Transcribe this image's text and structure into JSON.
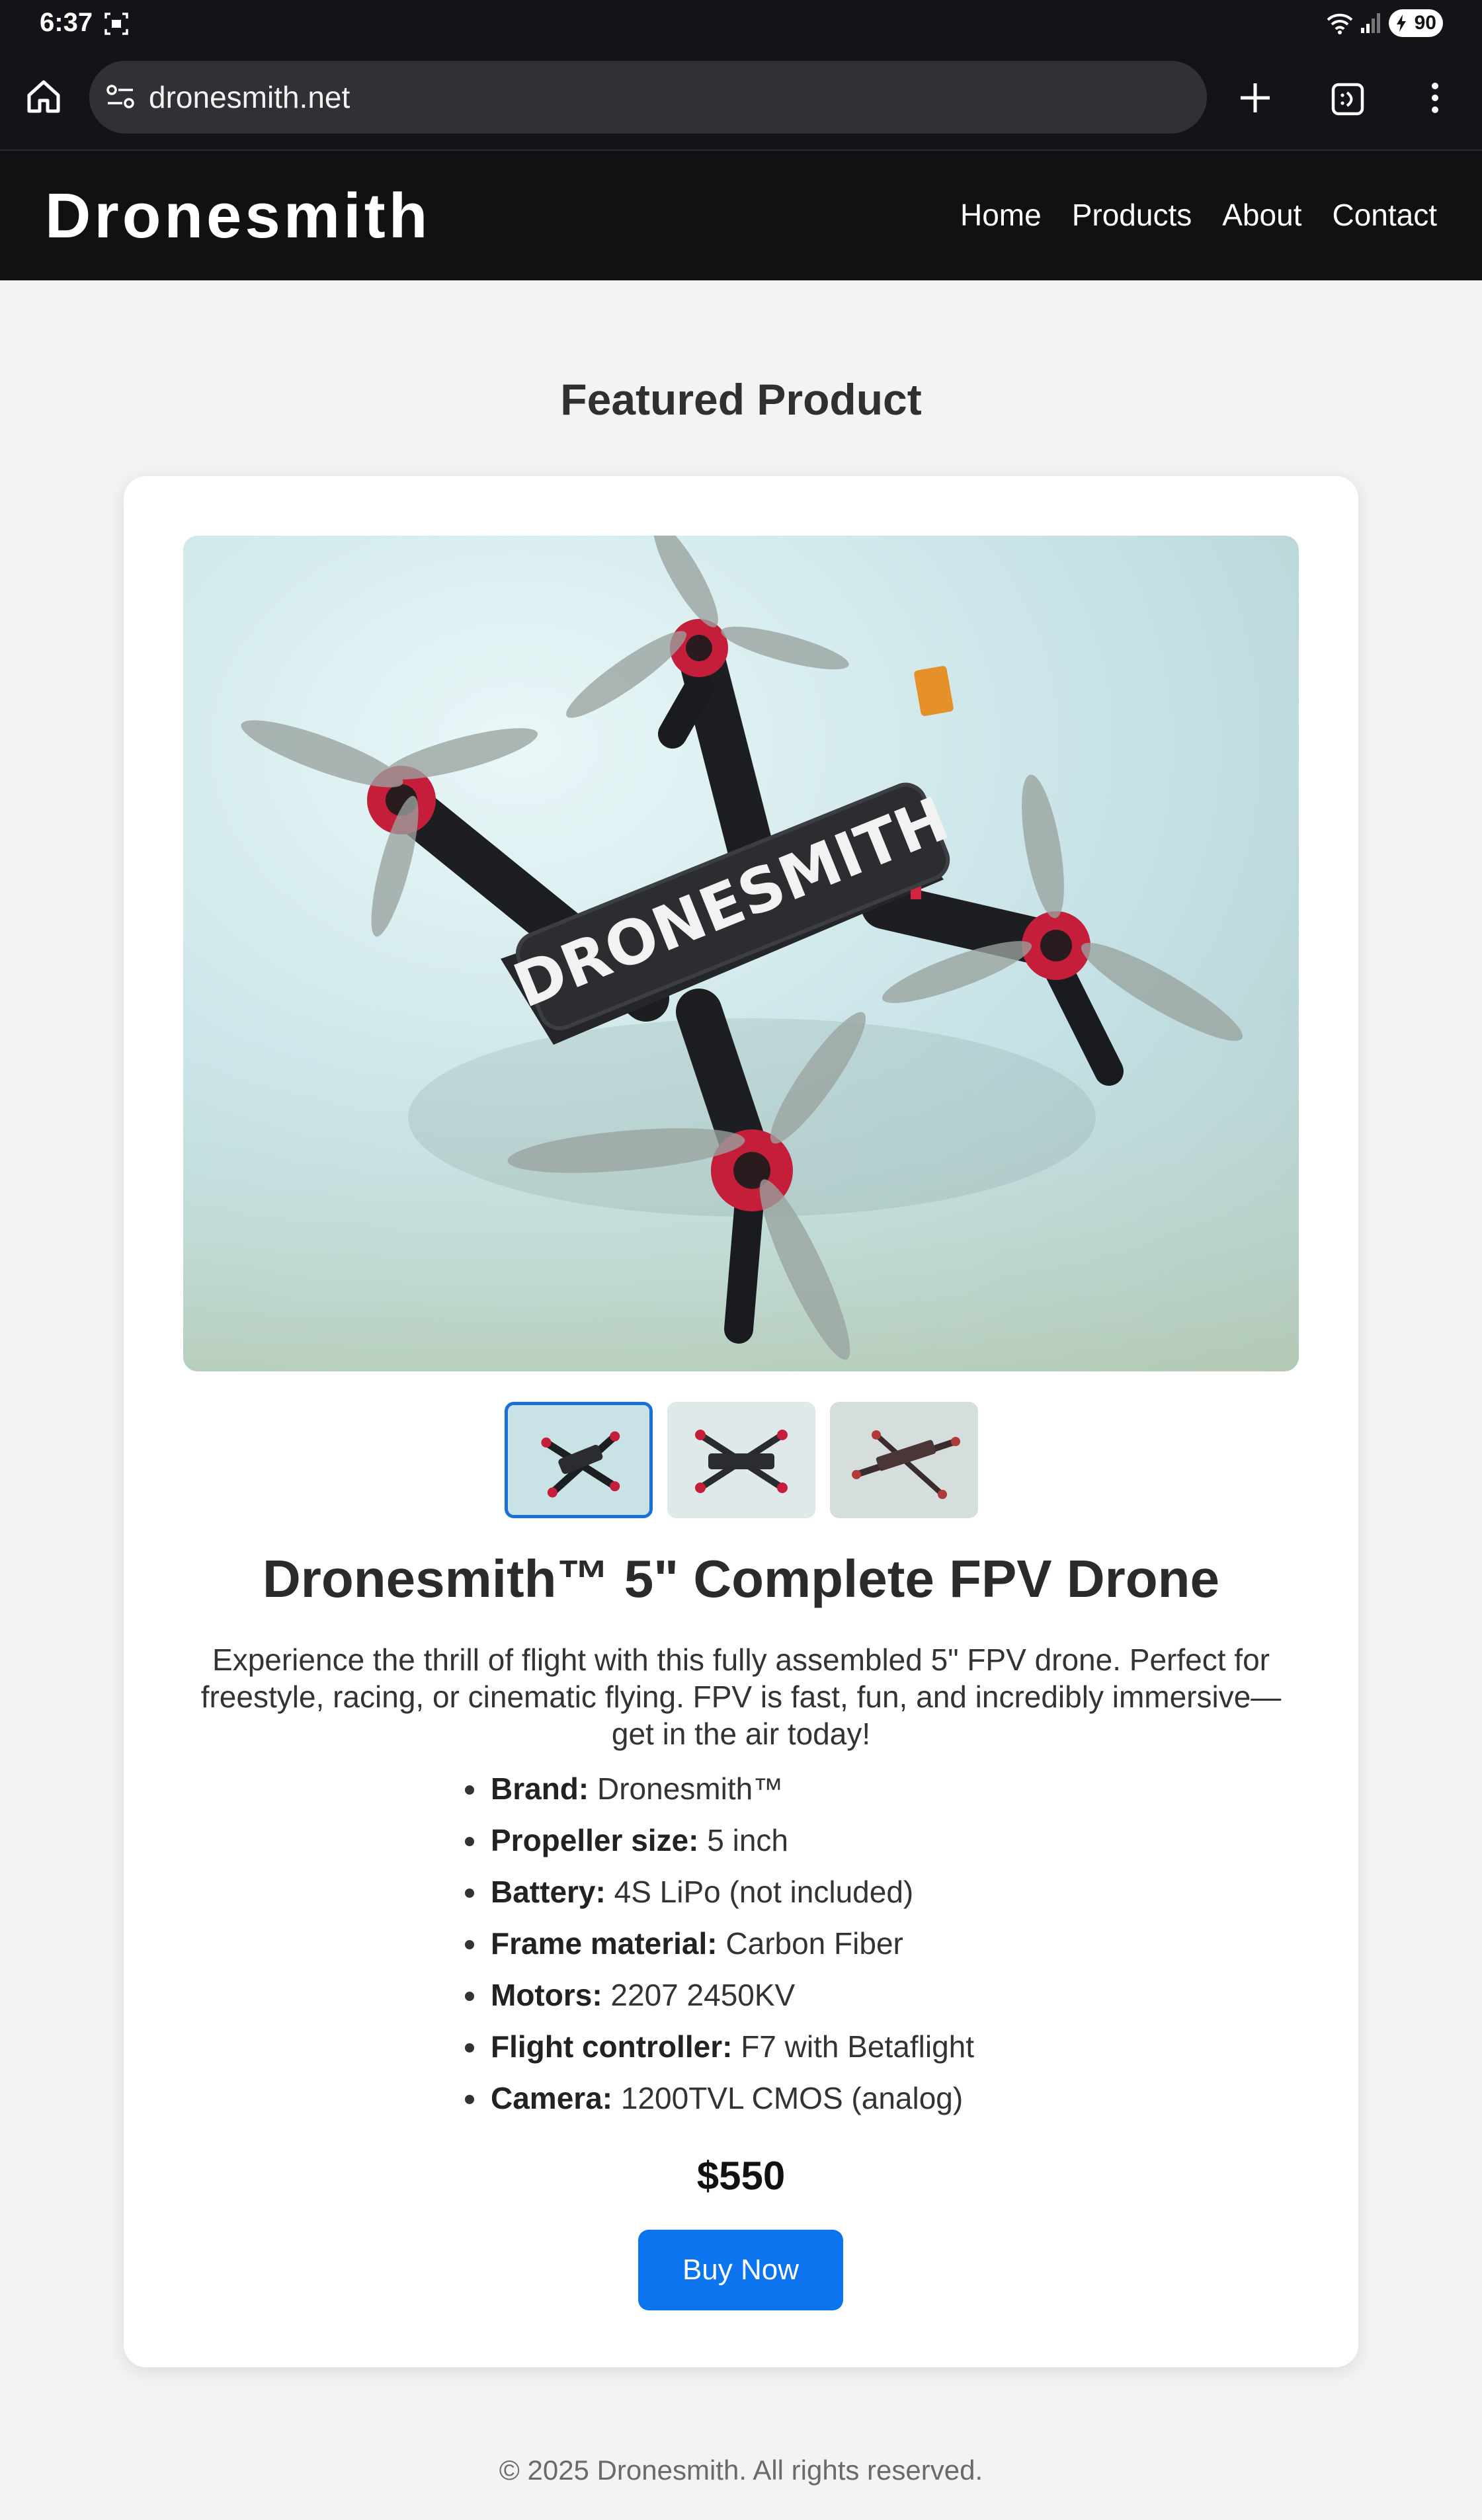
{
  "status_bar": {
    "time": "6:37",
    "battery": "90"
  },
  "browser": {
    "url": "dronesmith.net"
  },
  "site": {
    "logo": "Dronesmith",
    "nav": [
      {
        "label": "Home"
      },
      {
        "label": "Products"
      },
      {
        "label": "About"
      },
      {
        "label": "Contact"
      }
    ]
  },
  "main": {
    "section_title": "Featured Product",
    "product": {
      "image_text": "DRONESMITH",
      "title": "Dronesmith™ 5\" Complete FPV Drone",
      "description": "Experience the thrill of flight with this fully assembled 5\" FPV drone. Perfect for freestyle, racing, or cinematic flying. FPV is fast, fun, and incredibly immersive—get in the air today!",
      "specs": [
        {
          "label": "Brand:",
          "value": "Dronesmith™"
        },
        {
          "label": "Propeller size:",
          "value": "5 inch"
        },
        {
          "label": "Battery:",
          "value": "4S LiPo (not included)"
        },
        {
          "label": "Frame material:",
          "value": "Carbon Fiber"
        },
        {
          "label": "Motors:",
          "value": "2207 2450KV"
        },
        {
          "label": "Flight controller:",
          "value": "F7 with Betaflight"
        },
        {
          "label": "Camera:",
          "value": "1200TVL CMOS (analog)"
        }
      ],
      "price": "$550",
      "buy_label": "Buy Now"
    }
  },
  "footer": {
    "copyright": "© 2025 Dronesmith. All rights reserved."
  },
  "colors": {
    "accent": "#0b74ee",
    "header_bg": "#111113",
    "page_bg": "#f3f3f4"
  }
}
